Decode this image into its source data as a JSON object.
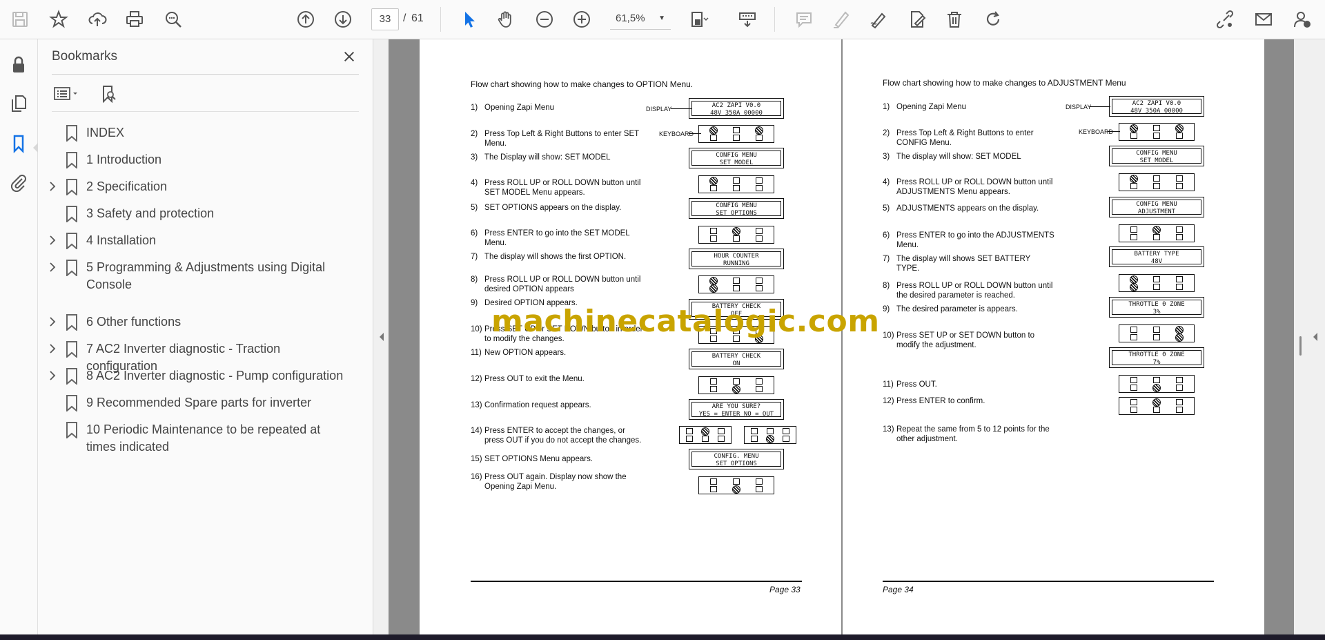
{
  "toolbar": {
    "current_page": "33",
    "page_separator": "/",
    "total_pages": "61",
    "zoom": "61,5%"
  },
  "bookmarks": {
    "title": "Bookmarks",
    "items": [
      {
        "label": "INDEX",
        "expandable": false
      },
      {
        "label": "1 Introduction",
        "expandable": false
      },
      {
        "label": "2 Specification",
        "expandable": true
      },
      {
        "label": "3 Safety and protection",
        "expandable": false
      },
      {
        "label": "4 Installation",
        "expandable": true
      },
      {
        "label": "5 Programming & Adjustments using Digital Console",
        "expandable": true
      },
      {
        "label": "6 Other functions",
        "expandable": true
      },
      {
        "label": "7 AC2 Inverter diagnostic - Traction configuration",
        "expandable": true
      },
      {
        "label": "8 AC2 Inverter diagnostic - Pump configuration",
        "expandable": true
      },
      {
        "label": "9 Recommended Spare parts for inverter",
        "expandable": false
      },
      {
        "label": "10 Periodic Maintenance to be repeated at times indicated",
        "expandable": false
      }
    ]
  },
  "page33": {
    "heading": "Flow chart showing how to make changes to OPTION Menu.",
    "display_label": "DISPLAY",
    "keyboard_label": "KEYBOARD",
    "steps": [
      {
        "n": "1)",
        "t": "Opening Zapi Menu"
      },
      {
        "n": "2)",
        "t": "Press Top Left & Right Buttons to enter SET Menu."
      },
      {
        "n": "3)",
        "t": "The Display will show: SET MODEL"
      },
      {
        "n": "4)",
        "t": "Press ROLL UP or ROLL DOWN button until SET MODEL Menu appears."
      },
      {
        "n": "5)",
        "t": "SET OPTIONS appears on the display."
      },
      {
        "n": "6)",
        "t": "Press ENTER to go into the SET MODEL Menu."
      },
      {
        "n": "7)",
        "t": "The display will shows the first OPTION."
      },
      {
        "n": "8)",
        "t": "Press ROLL UP or ROLL DOWN button until desired OPTION appears"
      },
      {
        "n": "9)",
        "t": "Desired OPTION appears."
      },
      {
        "n": "10)",
        "t": "Press SET UP or SET DOWN button in order to modify the changes."
      },
      {
        "n": "11)",
        "t": "New OPTION appears."
      },
      {
        "n": "12)",
        "t": "Press OUT to exit the Menu."
      },
      {
        "n": "13)",
        "t": "Confirmation request appears."
      },
      {
        "n": "14)",
        "t": "Press ENTER to accept the changes, or press OUT if you do not accept the changes."
      },
      {
        "n": "15)",
        "t": "SET OPTIONS Menu appears."
      },
      {
        "n": "16)",
        "t": "Press OUT again. Display now show the Opening Zapi Menu."
      }
    ],
    "displays": [
      [
        "AC2  ZAPI  V0.0",
        "48V  350A  00000"
      ],
      [
        "CONFIG  MENU",
        "SET  MODEL"
      ],
      [
        "CONFIG  MENU",
        "SET  OPTIONS"
      ],
      [
        "HOUR  COUNTER",
        "RUNNING"
      ],
      [
        "BATTERY  CHECK",
        "OFF"
      ],
      [
        "BATTERY  CHECK",
        "ON"
      ],
      [
        "ARE  YOU  SURE?",
        "YES = ENTER  NO = OUT"
      ],
      [
        "CONFIG.  MENU",
        "SET  OPTIONS"
      ]
    ],
    "page_number": "Page 33"
  },
  "page34": {
    "heading": "Flow chart showing how to make changes to ADJUSTMENT Menu",
    "display_label": "DISPLAY",
    "keyboard_label": "KEYBOARD",
    "steps": [
      {
        "n": "1)",
        "t": "Opening Zapi Menu"
      },
      {
        "n": "2)",
        "t": "Press Top Left & Right Buttons to enter CONFIG Menu."
      },
      {
        "n": "3)",
        "t": "The display will show: SET MODEL"
      },
      {
        "n": "4)",
        "t": "Press ROLL UP or ROLL DOWN button until ADJUSTMENTS Menu appears."
      },
      {
        "n": "5)",
        "t": "ADJUSTMENTS appears on the display."
      },
      {
        "n": "6)",
        "t": "Press ENTER to go into the ADJUSTMENTS Menu."
      },
      {
        "n": "7)",
        "t": "The display will shows SET BATTERY TYPE."
      },
      {
        "n": "8)",
        "t": "Press ROLL UP or ROLL DOWN button until the desired parameter is reached."
      },
      {
        "n": "9)",
        "t": "The desired parameter is appears."
      },
      {
        "n": "10)",
        "t": "Press SET UP or SET DOWN button to modify the adjustment."
      },
      {
        "n": "11)",
        "t": "Press OUT."
      },
      {
        "n": "12)",
        "t": "Press ENTER to confirm."
      },
      {
        "n": "13)",
        "t": "Repeat the same from 5 to 12 points for  the other adjustment."
      }
    ],
    "displays": [
      [
        "AC2  ZAPI  V0.0",
        "48V  350A  00000"
      ],
      [
        "CONFIG  MENU",
        "SET  MODEL"
      ],
      [
        "CONFIG  MENU",
        "ADJUSTMENT"
      ],
      [
        "BATTERY  TYPE",
        "48V"
      ],
      [
        "THROTTLE  0  ZONE",
        "3%"
      ],
      [
        "THROTTLE  0  ZONE",
        "7%"
      ]
    ],
    "page_number": "Page 34"
  },
  "watermark": "machinecatalogic.com",
  "colors": {
    "accent": "#1473e6",
    "watermark": "#c9a400"
  }
}
